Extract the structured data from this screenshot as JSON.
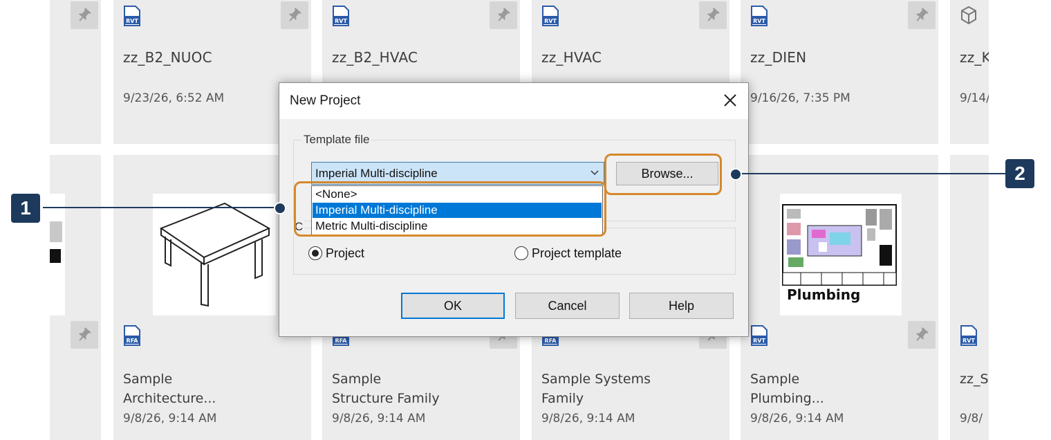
{
  "cards_top": [
    {
      "title": "zz_B2_NUOC",
      "date": "9/23/26, 6:52 AM",
      "badge": "RVT"
    },
    {
      "title": "zz_B2_HVAC",
      "date": "",
      "badge": "RVT"
    },
    {
      "title": "zz_HVAC",
      "date": "",
      "badge": "RVT"
    },
    {
      "title": "zz_DIEN",
      "date": "9/16/26, 7:35 PM",
      "badge": "RVT"
    },
    {
      "title": "zz_K",
      "date": "9/14/",
      "badge": ""
    }
  ],
  "cards_bottom": [
    {
      "line1": "Sample",
      "line2": "Architecture...",
      "date": "9/8/26, 9:14 AM",
      "badge": "RFA"
    },
    {
      "line1": "Sample",
      "line2": "Structure Family",
      "date": "9/8/26, 9:14 AM",
      "badge": "RFA"
    },
    {
      "line1": "Sample Systems",
      "line2": "Family",
      "date": "9/8/26, 9:14 AM",
      "badge": "RFA"
    },
    {
      "line1": "Sample",
      "line2": "Plumbing...",
      "date": "9/8/26, 9:14 AM",
      "badge": "RVT"
    },
    {
      "line1": "zz_S",
      "line2": "",
      "date": "9/8/",
      "badge": "RVT"
    }
  ],
  "plumbing_thumb_label": "Plumbing",
  "dialog": {
    "title": "New Project",
    "template_group_label": "Template file",
    "selected_template": "Imperial Multi-discipline",
    "browse_label": "Browse...",
    "dropdown_options": [
      "<None>",
      "Imperial Multi-discipline",
      "Metric Multi-discipline"
    ],
    "create_new_group_label_initial": "C",
    "radio_project": "Project",
    "radio_template": "Project template",
    "ok_label": "OK",
    "cancel_label": "Cancel",
    "help_label": "Help"
  },
  "callouts": {
    "one": "1",
    "two": "2"
  },
  "colors": {
    "highlight": "#d6882c",
    "callout": "#1d3a5c",
    "selection": "#0078d7"
  }
}
